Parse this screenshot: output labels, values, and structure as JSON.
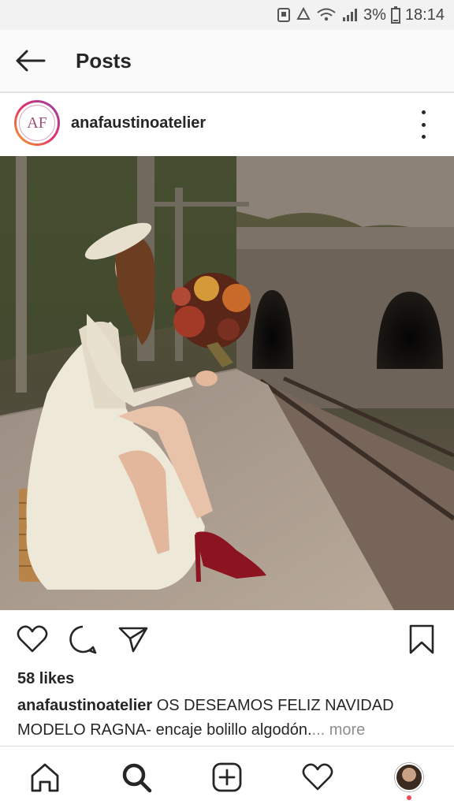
{
  "status_bar": {
    "battery": "3%",
    "time": "18:14"
  },
  "app_bar": {
    "title": "Posts",
    "back_icon": "arrow-left-icon"
  },
  "post": {
    "username": "anafaustinoatelier",
    "avatar_logo": "AF",
    "likes": "58 likes",
    "caption_user": "anafaustinoatelier",
    "caption_text": " OS DESEAMOS FELIZ NAVIDAD MODELO RAGNA- encaje bolillo algodón.",
    "more_label": "... more"
  },
  "actions": [
    "heart-icon",
    "comment-icon",
    "share-icon",
    "bookmark-icon"
  ],
  "bottom_nav": [
    "home-icon",
    "search-icon",
    "new-post-icon",
    "activity-heart-icon",
    "profile-avatar"
  ],
  "colors": {
    "accent_dot": "#ed4956",
    "text": "#262626",
    "muted": "#8e8e8e"
  }
}
